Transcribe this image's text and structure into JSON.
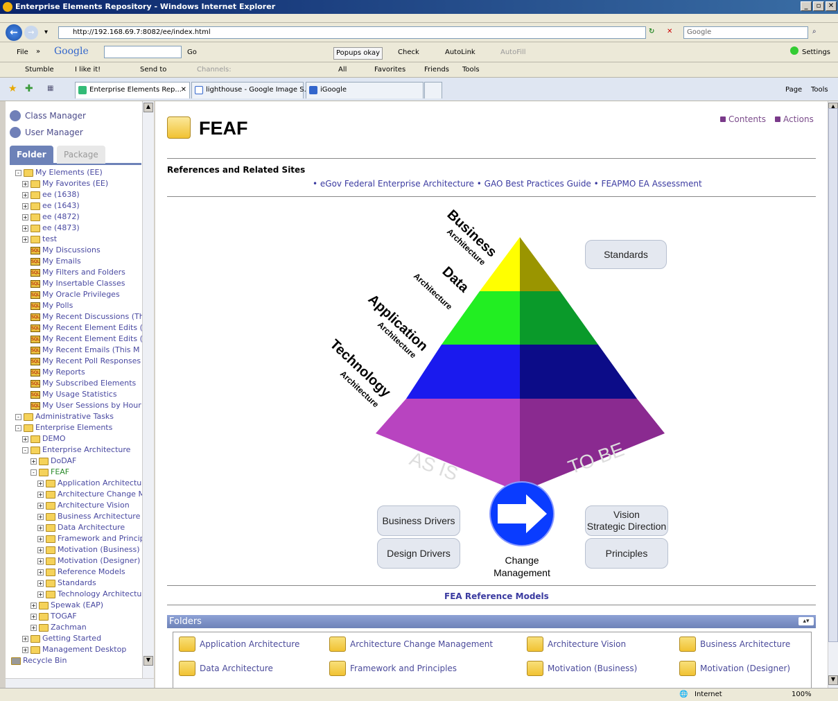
{
  "window": {
    "title": "Enterprise Elements Repository - Windows Internet Explorer"
  },
  "address": {
    "url": "http://192.168.69.7:8082/ee/index.html",
    "search_placeholder": "Google"
  },
  "toolbar1": {
    "file": "File",
    "google": "Google",
    "go": "Go",
    "popups": "Popups okay",
    "check": "Check",
    "autolink": "AutoLink",
    "autofill": "AutoFill",
    "settings": "Settings"
  },
  "toolbar2": {
    "stumble": "Stumble",
    "ilike": "I like it!",
    "sendto": "Send to",
    "channels": "Channels:",
    "all": "All",
    "favorites": "Favorites",
    "friends": "Friends",
    "tools": "Tools"
  },
  "tabs": [
    {
      "label": "Enterprise Elements Rep..."
    },
    {
      "label": "lighthouse - Google Image S..."
    },
    {
      "label": "iGoogle"
    }
  ],
  "cmd": {
    "page": "Page",
    "tools": "Tools"
  },
  "sidebar": {
    "managers": [
      "Class Manager",
      "User Manager"
    ],
    "tab_folder": "Folder",
    "tab_package": "Package",
    "tree": [
      "My Elements (EE)",
      "My Favorites (EE)",
      "ee (1638)",
      "ee (1643)",
      "ee (4872)",
      "ee (4873)",
      "test",
      "My Discussions",
      "My Emails",
      "My Filters and Folders",
      "My Insertable Classes",
      "My Oracle Privileges",
      "My Polls",
      "My Recent Discussions (Th",
      "My Recent Element Edits (",
      "My Recent Element Edits (",
      "My Recent Emails (This M",
      "My Recent Poll Responses",
      "My Reports",
      "My Subscribed Elements",
      "My Usage Statistics",
      "My User Sessions by Hour",
      "Administrative Tasks",
      "Enterprise Elements",
      "DEMO",
      "Enterprise Architecture",
      "DoDAF",
      "FEAF",
      "Application Architectur",
      "Architecture Change M",
      "Architecture Vision",
      "Business Architecture",
      "Data Architecture",
      "Framework and Princip",
      "Motivation (Business)",
      "Motivation (Designer)",
      "Reference Models",
      "Standards",
      "Technology Architectur",
      "Spewak (EAP)",
      "TOGAF",
      "Zachman",
      "Getting Started",
      "Management Desktop",
      "Recycle Bin"
    ]
  },
  "main": {
    "title": "FEAF",
    "contents": "Contents",
    "actions": "Actions",
    "refs_heading": "References and Related Sites",
    "links": [
      "eGov Federal Enterprise Architecture",
      "GAO Best Practices Guide",
      "FEAPMO EA Assessment"
    ],
    "pyramid": {
      "layers": [
        {
          "big": "Business",
          "small": "Architecture"
        },
        {
          "big": "Data",
          "small": "Architecture"
        },
        {
          "big": "Application",
          "small": "Architecture"
        },
        {
          "big": "Technology",
          "small": "Architecture"
        }
      ],
      "as_is": "AS IS",
      "to_be": "TO BE",
      "colors": {
        "business": "#ffff00",
        "business_dark": "#9a9500",
        "data": "#22ee22",
        "data_dark": "#0a9a2a",
        "app": "#1a1aee",
        "app_dark": "#0c0c88",
        "tech": "#b844c0",
        "tech_dark": "#8a2a90"
      }
    },
    "buttons": {
      "standards": "Standards",
      "business_drivers": "Business Drivers",
      "design_drivers": "Design Drivers",
      "vision_1": "Vision",
      "vision_2": "Strategic Direction",
      "principles": "Principles",
      "change_1": "Change",
      "change_2": "Management"
    },
    "fea_models": "FEA Reference Models",
    "folders_title": "Folders",
    "folders": [
      "Application Architecture",
      "Architecture Change Management",
      "Architecture Vision",
      "Business Architecture",
      "Data Architecture",
      "Framework and Principles",
      "Motivation (Business)",
      "Motivation (Designer)"
    ]
  },
  "status": {
    "zone": "Internet",
    "zoom": "100%"
  }
}
